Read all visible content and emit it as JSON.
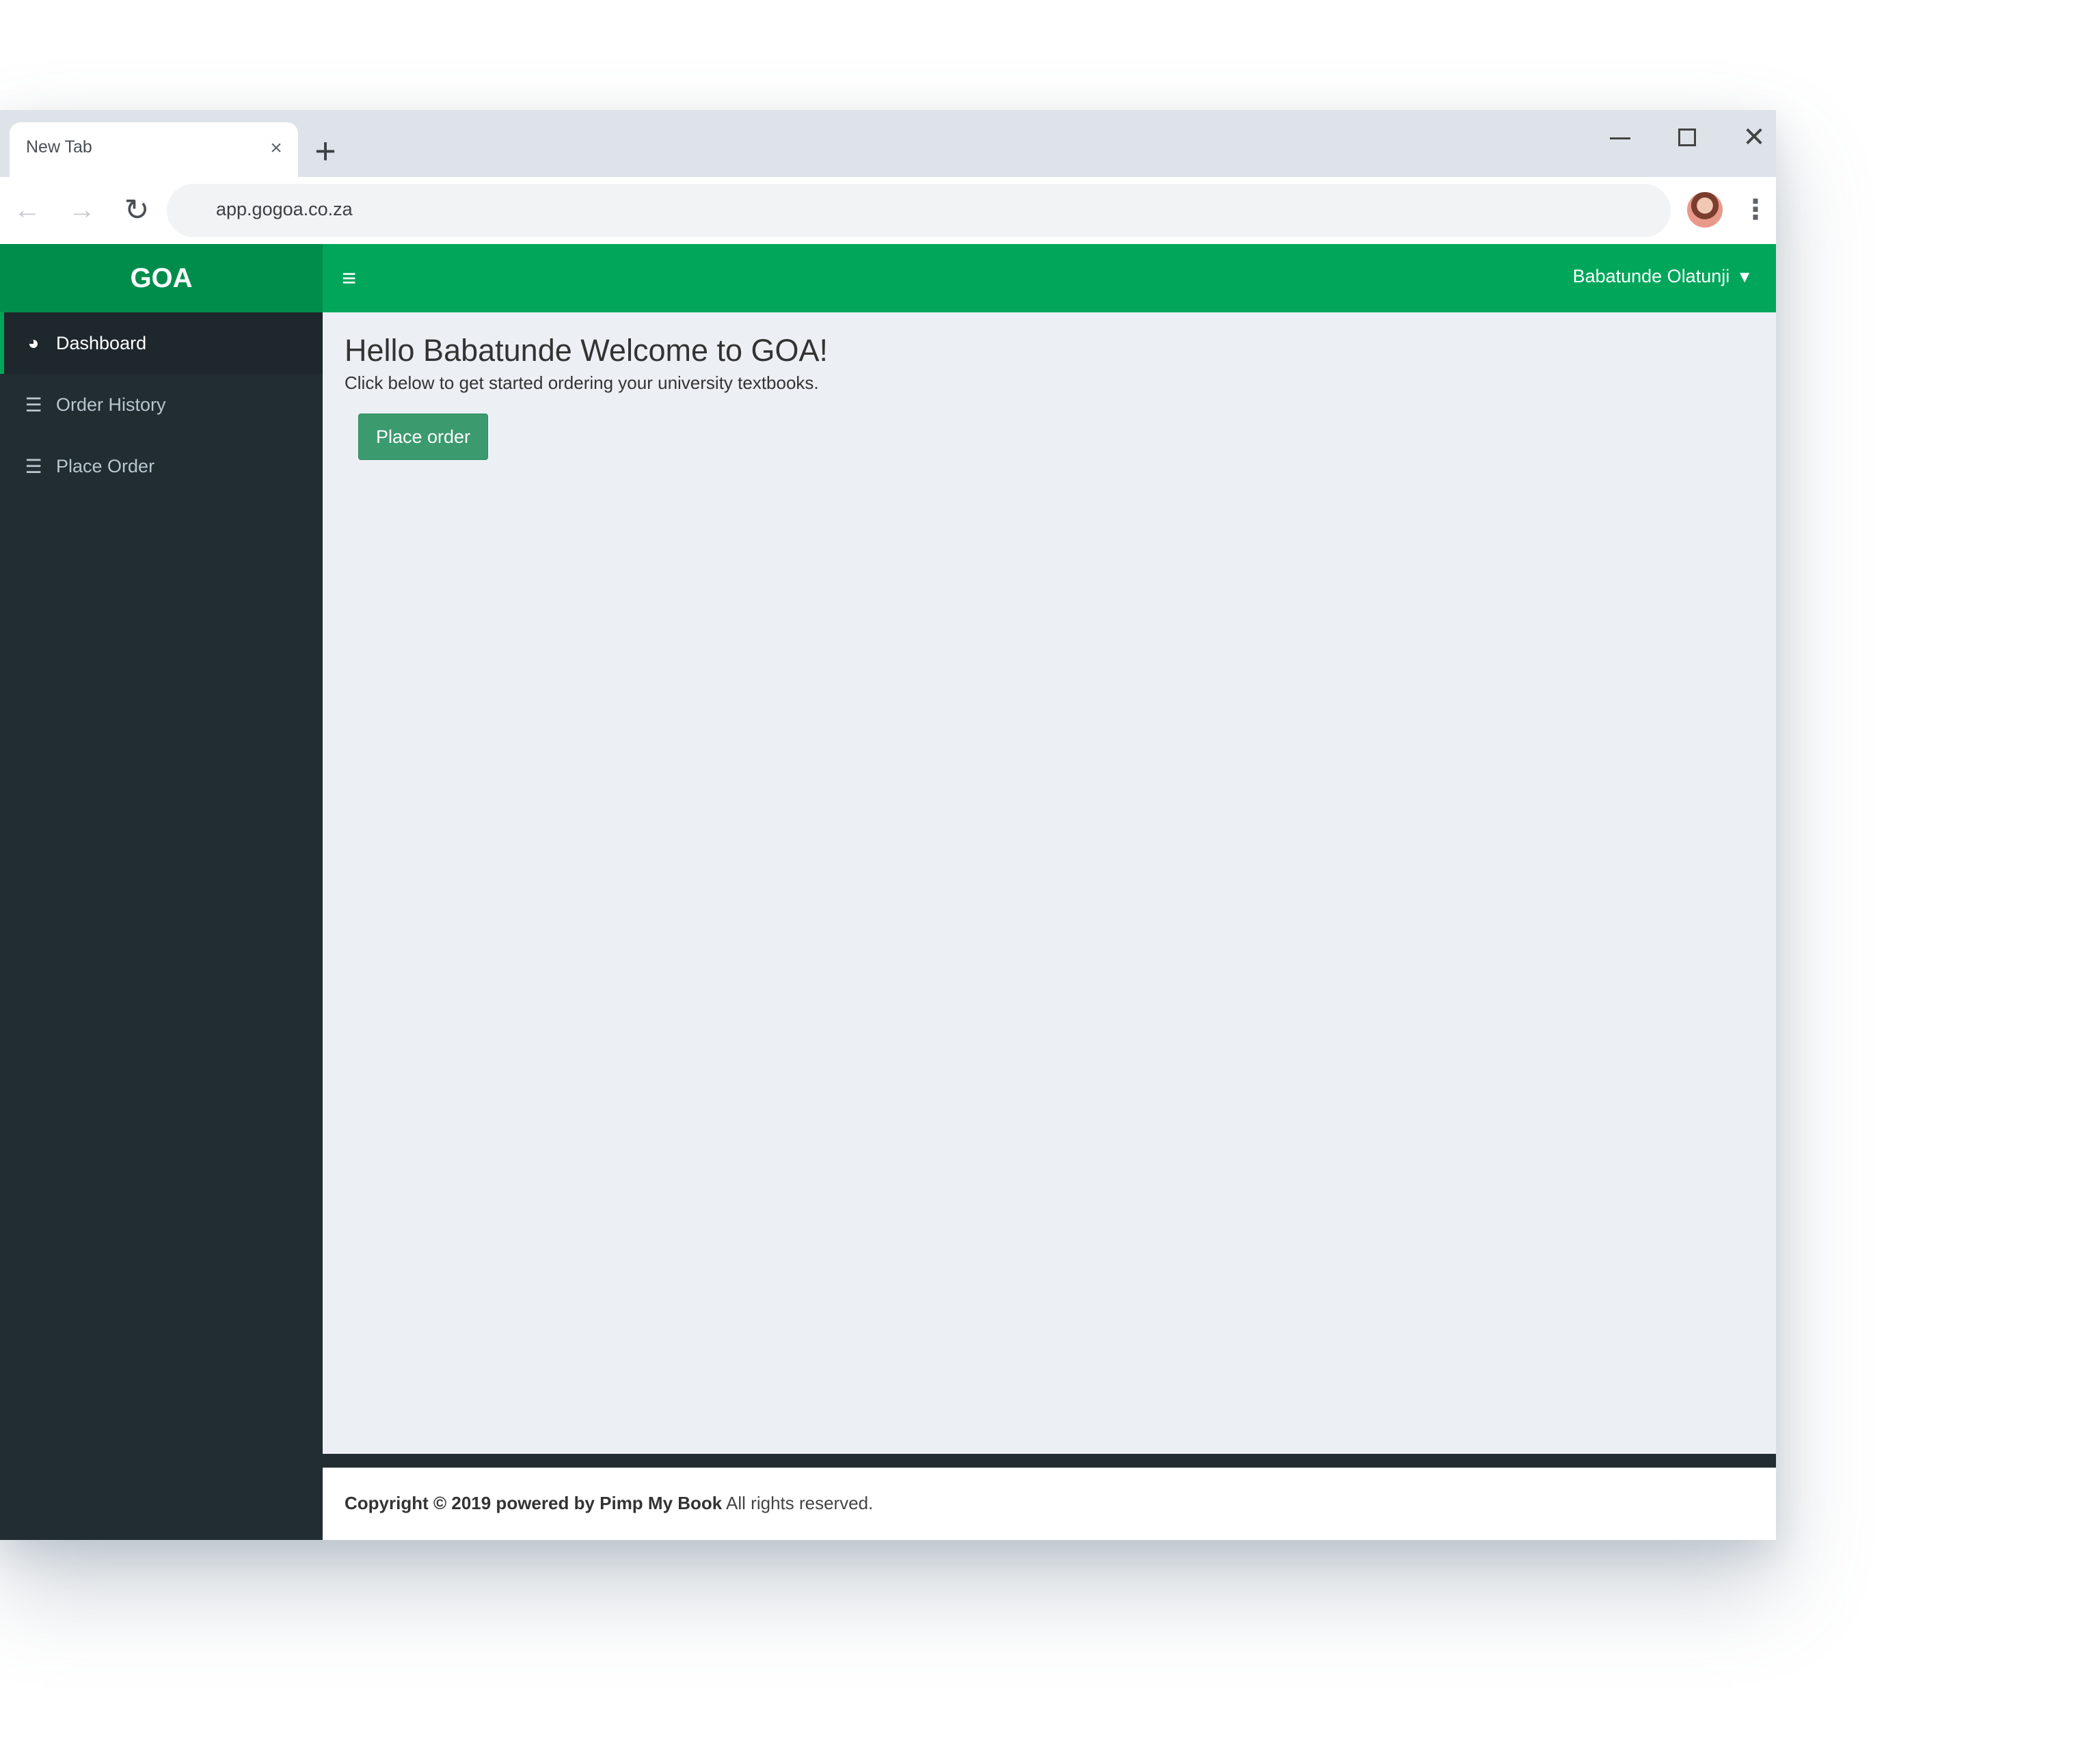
{
  "browser": {
    "tab_title": "New Tab",
    "tab_close_symbol": "×",
    "new_tab_symbol": "+",
    "url": "app.gogoa.co.za",
    "icons": {
      "back": "arrow-left-icon",
      "forward": "arrow-right-icon",
      "reload": "reload-icon",
      "star": "bookmark-star-icon",
      "menu": "kebab-menu-icon"
    }
  },
  "app": {
    "brand": "GOA",
    "brand_color": "#008d4c",
    "header_color": "#00a65a",
    "sidebar_color": "#222d32",
    "user_name": "Babatunde Olatunji",
    "sidebar": {
      "items": [
        {
          "label": "Dashboard",
          "icon": "dashboard-icon",
          "active": true
        },
        {
          "label": "Order History",
          "icon": "list-icon",
          "active": false
        },
        {
          "label": "Place Order",
          "icon": "list-icon",
          "active": false
        }
      ]
    },
    "main": {
      "title": "Hello Babatunde Welcome to GOA!",
      "subtitle": "Click below to get started ordering your university textbooks.",
      "place_order_button": "Place order"
    },
    "footer": {
      "copyright_bold": "Copyright © 2019 powered by Pimp My Book",
      "rights": " All rights reserved."
    }
  }
}
